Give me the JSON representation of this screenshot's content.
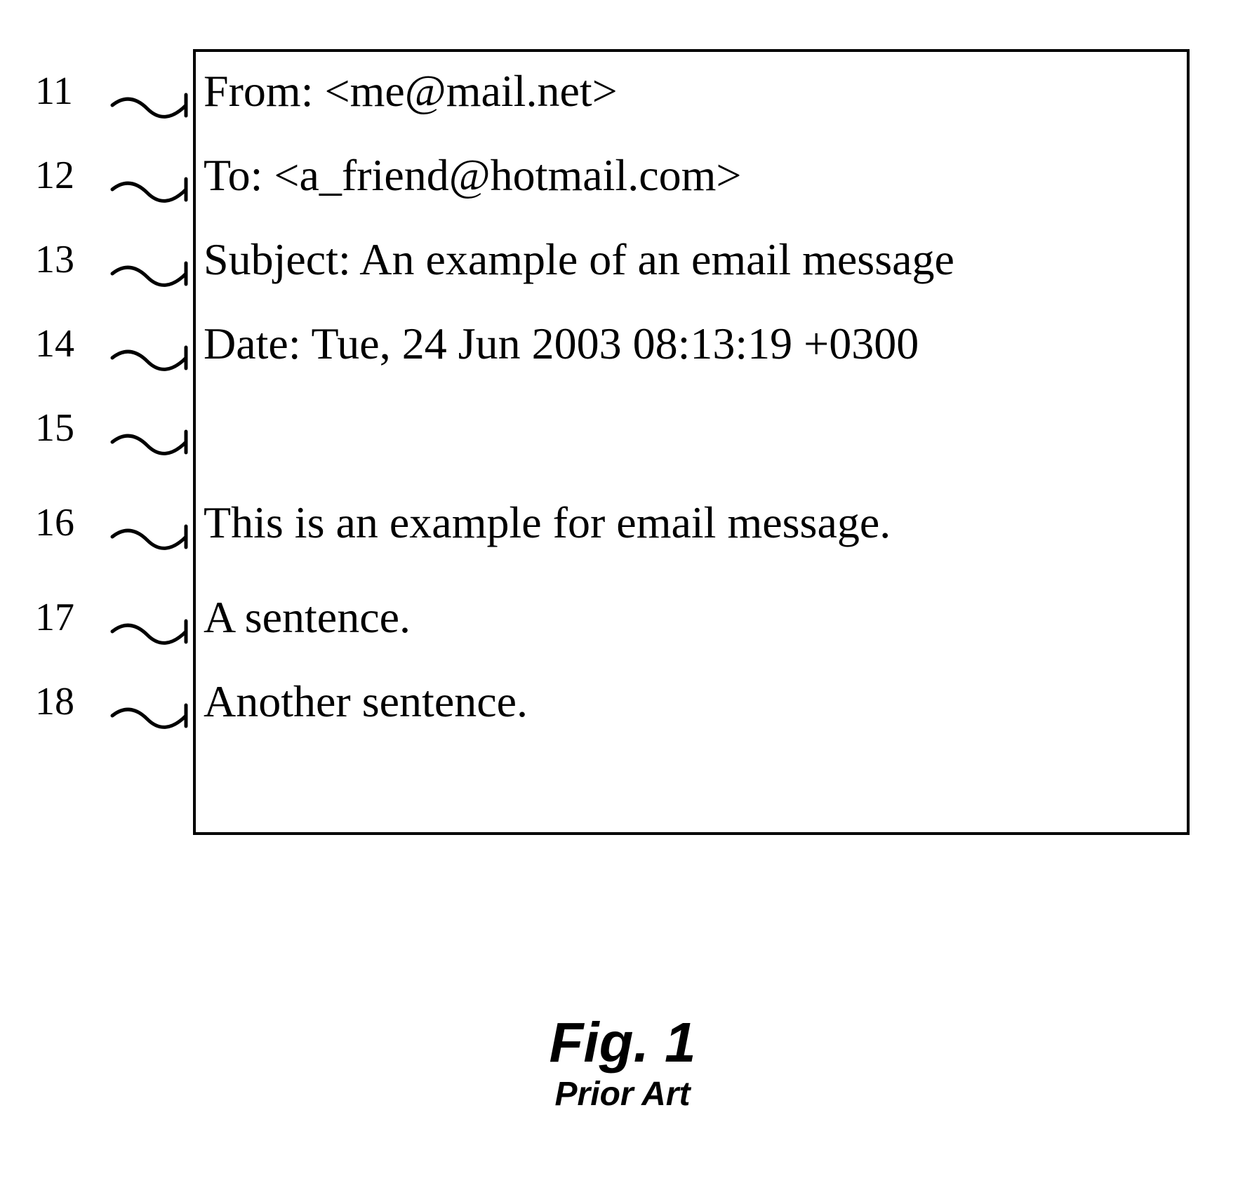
{
  "callouts": {
    "n11": "11",
    "n12": "12",
    "n13": "13",
    "n14": "14",
    "n15": "15",
    "n16": "16",
    "n17": "17",
    "n18": "18"
  },
  "email": {
    "from": "From: <me@mail.net>",
    "to": "To: <a_friend@hotmail.com>",
    "subject": "Subject: An example of an email message",
    "date": "Date: Tue, 24 Jun 2003 08:13:19 +0300",
    "blank": " ",
    "body1": "This is an example for email message.",
    "body2": "A sentence.",
    "body3": "Another sentence."
  },
  "caption": {
    "title": "Fig. 1",
    "sub": "Prior Art"
  }
}
